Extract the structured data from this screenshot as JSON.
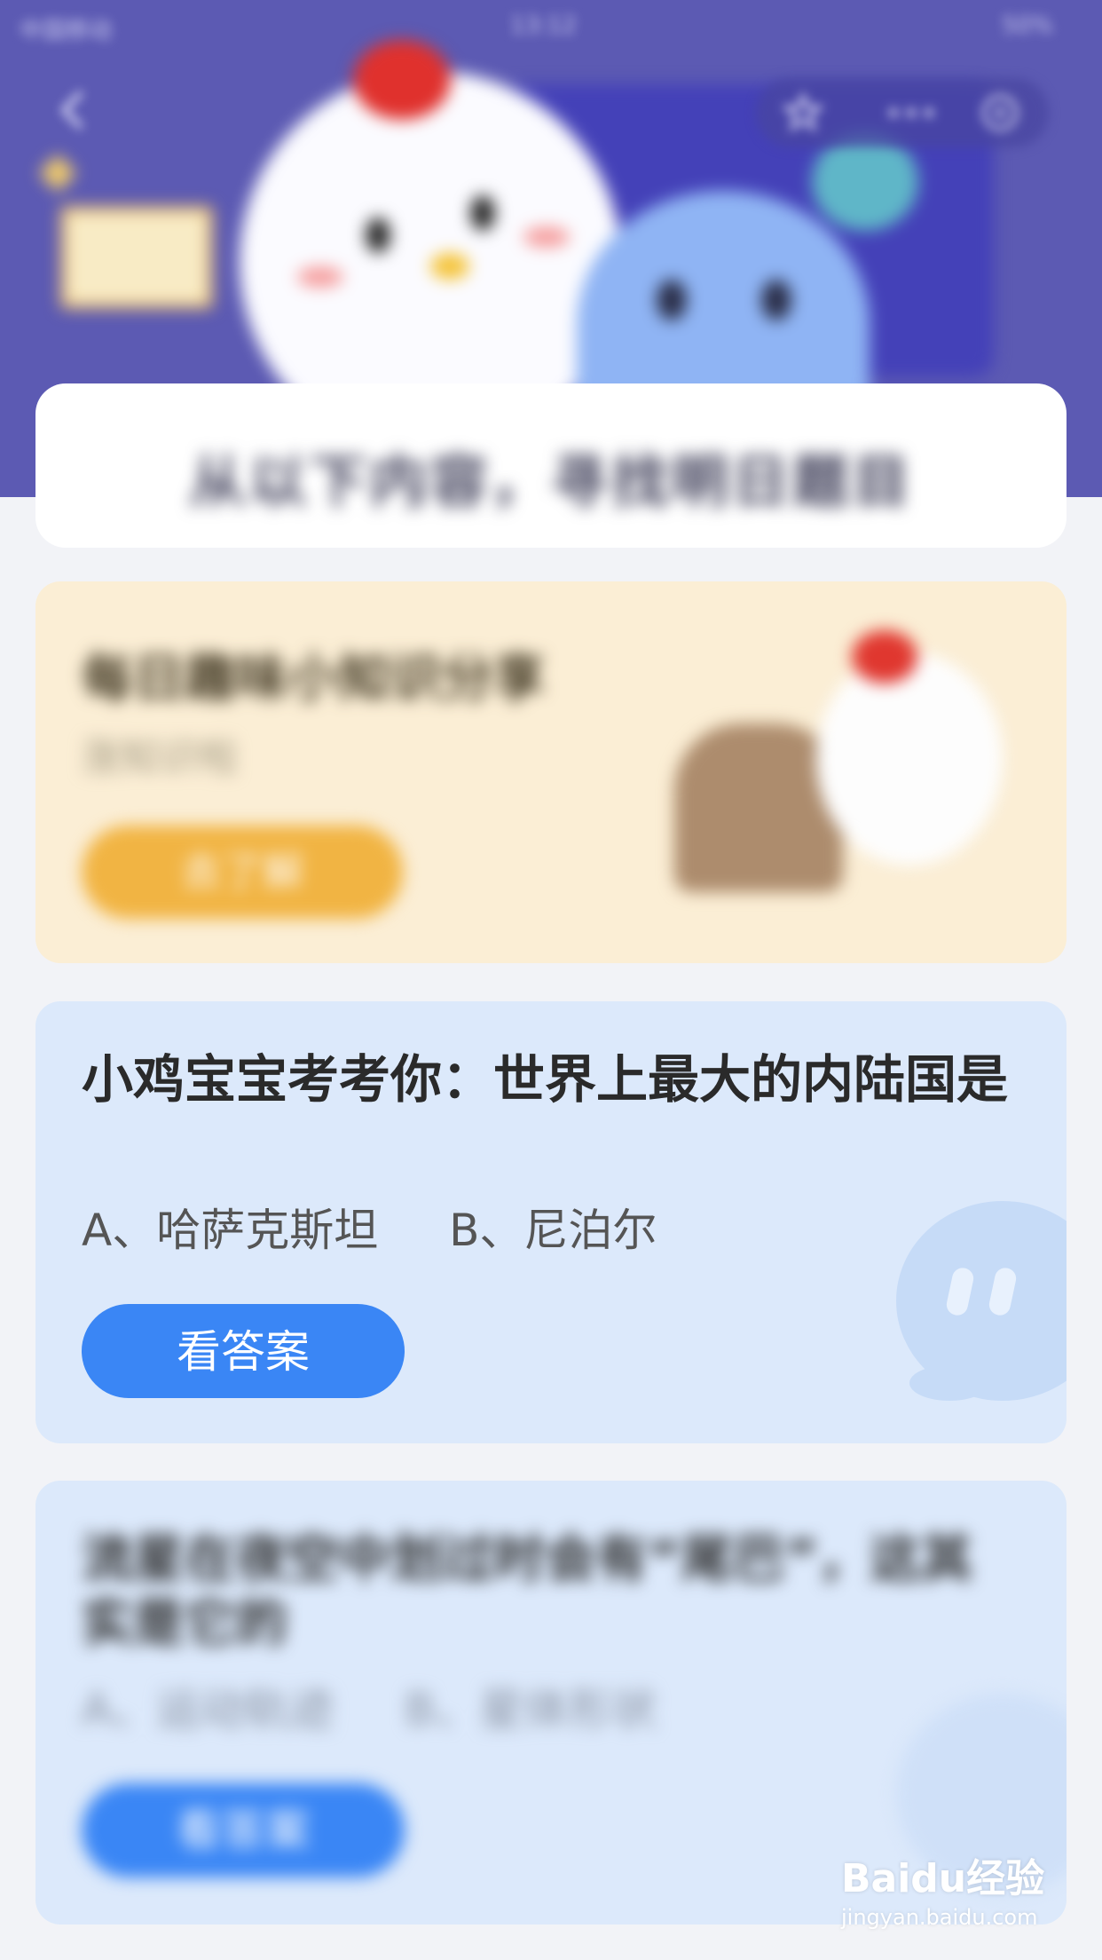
{
  "status_bar": {
    "carrier": "中国移动",
    "time": "13:12",
    "battery": "50%"
  },
  "header": {
    "title": "从以下内容，寻找明日题目"
  },
  "knowledge_card": {
    "title": "每日趣味小知识分享",
    "subtitle": "涨知识啦",
    "button_label": "去了解"
  },
  "quiz_cards": [
    {
      "question": "小鸡宝宝考考你：世界上最大的内陆国是",
      "option_a": "A、哈萨克斯坦",
      "option_b": "B、尼泊尔",
      "button_label": "看答案"
    },
    {
      "question": "流星在夜空中划过时会有“尾巴”，这其实是它的",
      "option_a": "A、运动轨迹",
      "option_b": "B、星体形状",
      "button_label": "看答案"
    }
  ],
  "watermark": {
    "brand": "Baidu经验",
    "url": "jingyan.baidu.com"
  },
  "colors": {
    "header_bg": "#5c5ab3",
    "primary_button": "#3a86f5",
    "knowledge_button": "#f1b443",
    "quiz_card_bg": "#dce9fb"
  }
}
